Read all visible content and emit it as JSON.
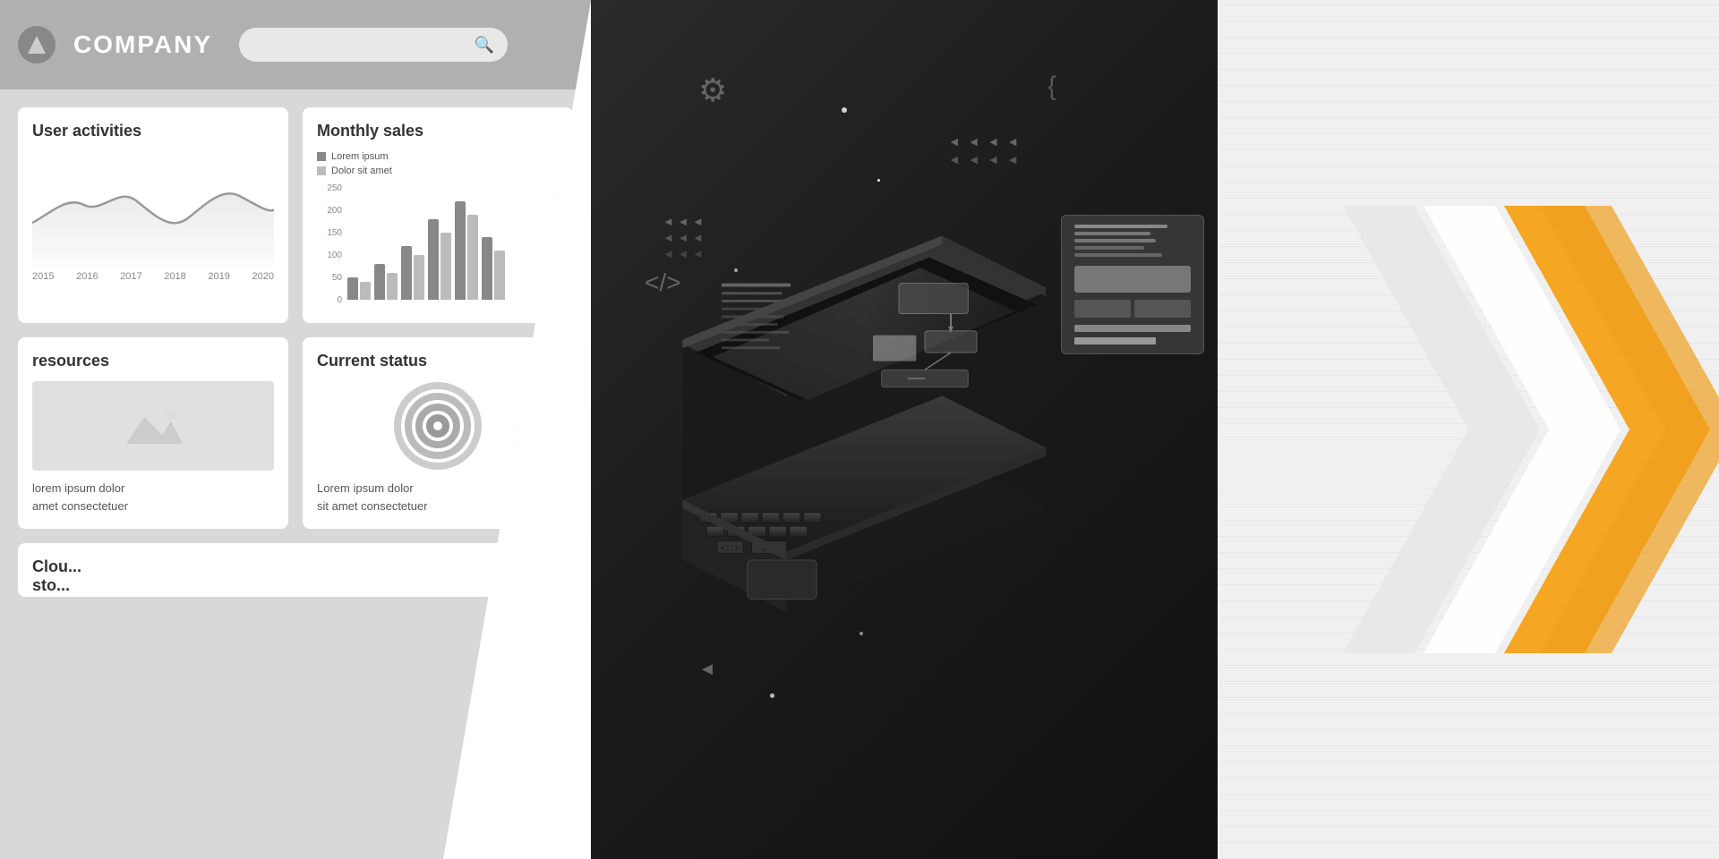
{
  "header": {
    "company_name": "COMPANY",
    "search_placeholder": ""
  },
  "dashboard": {
    "cards": [
      {
        "id": "user-activities",
        "title": "User activities",
        "type": "line-chart",
        "years": [
          "2015",
          "2016",
          "2017",
          "2018",
          "2019",
          "2020"
        ]
      },
      {
        "id": "monthly-sales",
        "title": "Monthly sales",
        "type": "bar-chart",
        "legend": [
          {
            "label": "Lorem ipsum",
            "color": "dark"
          },
          {
            "label": "Dolor sit amet",
            "color": "light"
          }
        ],
        "y_axis": [
          "250",
          "200",
          "150",
          "100",
          "50",
          "0"
        ]
      },
      {
        "id": "resources",
        "title": "resources",
        "type": "image",
        "description_line1": "lorem ipsum dolor",
        "description_line2": "amet consectetuer"
      },
      {
        "id": "current-status",
        "title": "Current status",
        "type": "radial",
        "description_line1": "Lorem ipsum dolor",
        "description_line2": "sit amet consectetuer"
      },
      {
        "id": "cloud",
        "title": "Clou",
        "subtitle": "sto",
        "type": "partial"
      }
    ]
  },
  "middle": {
    "floating_elements": [
      {
        "type": "gear",
        "symbol": "⚙"
      },
      {
        "type": "brackets",
        "symbol": "{ }"
      },
      {
        "type": "arrows",
        "symbol": "◄◄◄◄"
      },
      {
        "type": "code-bracket",
        "symbol": "</>"
      },
      {
        "type": "tri-arrows",
        "symbol": "◄◄◄"
      },
      {
        "type": "cursor",
        "symbol": "◄"
      }
    ]
  },
  "right": {
    "chevrons": {
      "colors": [
        "#f5a623",
        "#f5a623",
        "#ffffff",
        "#e0e0e0"
      ],
      "count": 3
    }
  }
}
